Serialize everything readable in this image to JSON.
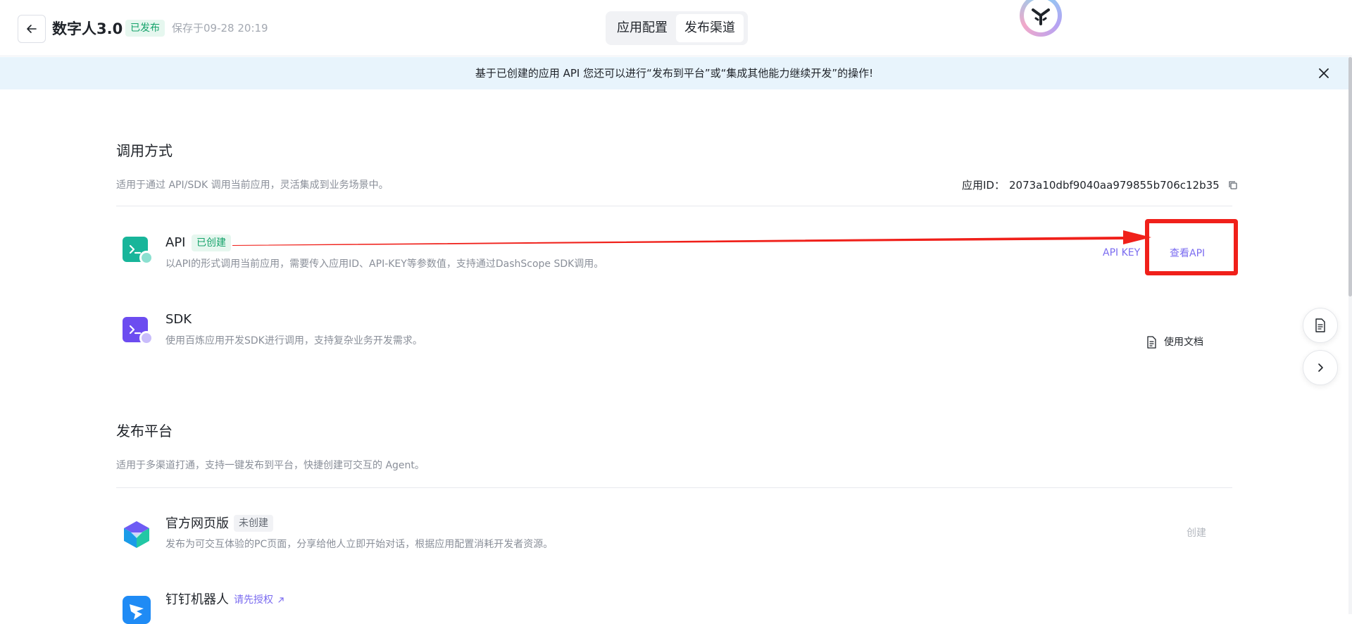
{
  "header": {
    "app_title": "数字人3.0",
    "status_badge": "已发布",
    "saved_at": "保存于09-28 20:19",
    "tabs": [
      {
        "label": "应用配置",
        "active": false
      },
      {
        "label": "发布渠道",
        "active": true
      }
    ]
  },
  "notice": {
    "text": "基于已创建的应用 API 您还可以进行“发布到平台”或“集成其他能力继续开发”的操作!"
  },
  "invocation": {
    "title": "调用方式",
    "description": "适用于通过 API/SDK 调用当前应用，灵活集成到业务场景中。",
    "app_id_label": "应用ID：",
    "app_id": "2073a10dbf9040aa979855b706c12b35",
    "items": [
      {
        "name": "API",
        "badge": "已创建",
        "description": "以API的形式调用当前应用，需要传入应用ID、API-KEY等参数值，支持通过DashScope SDK调用。",
        "action_secondary": "API KEY",
        "action_primary": "查看API"
      },
      {
        "name": "SDK",
        "description": "使用百炼应用开发SDK进行调用，支持复杂业务开发需求。",
        "action_primary": "使用文档"
      }
    ]
  },
  "platforms": {
    "title": "发布平台",
    "description": "适用于多渠道打通，支持一键发布到平台，快捷创建可交互的 Agent。",
    "items": [
      {
        "name": "官方网页版",
        "badge": "未创建",
        "description": "发布为可交互体验的PC页面，分享给他人立即开始对话，根据应用配置消耗开发者资源。",
        "action": "创建"
      },
      {
        "name": "钉钉机器人",
        "auth_link": "请先授权"
      }
    ]
  },
  "colors": {
    "accent_purple": "#7b6cf0",
    "success_green": "#16a36b",
    "annotation_red": "#f0201a",
    "notice_bg": "#e8f4fc"
  },
  "icons": [
    "back-arrow-icon",
    "close-icon",
    "terminal-icon",
    "document-icon",
    "chevron-right-icon",
    "external-link-icon"
  ]
}
